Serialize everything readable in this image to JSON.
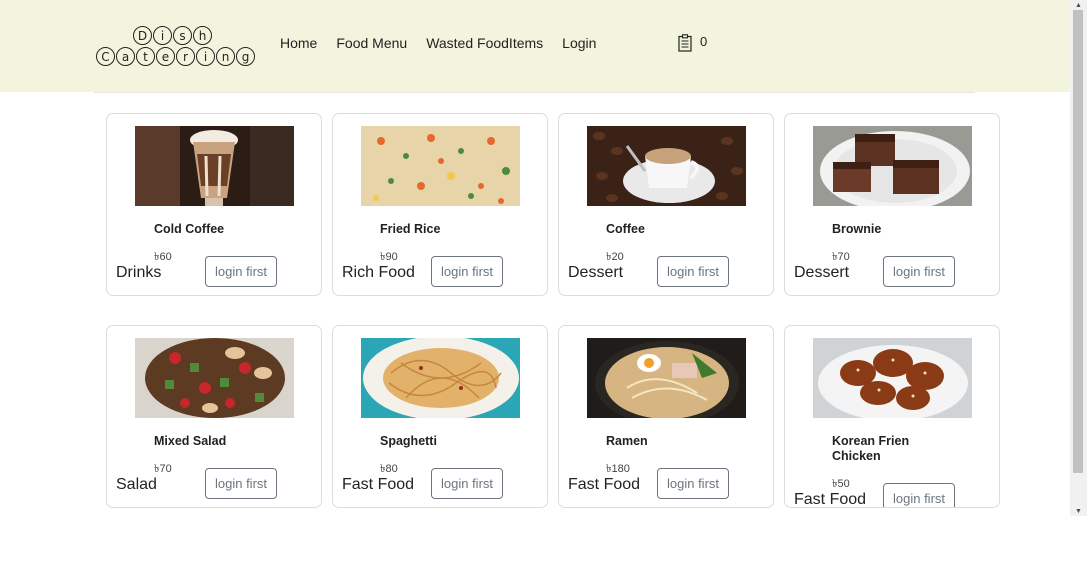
{
  "brand": {
    "line1": [
      "D",
      "i",
      "s",
      "h"
    ],
    "line2": [
      "C",
      "a",
      "t",
      "e",
      "r",
      "i",
      "n",
      "g"
    ]
  },
  "nav": {
    "items": [
      "Home",
      "Food Menu",
      "Wasted FoodItems",
      "Login"
    ]
  },
  "cart": {
    "icon": "clipboard-list-icon",
    "count": "0"
  },
  "colors": {
    "navbar_bg": "#f3f4dd",
    "button_border": "#6c757d"
  },
  "products": [
    {
      "name": "Cold Coffee",
      "price": "৳60",
      "category": "Drinks",
      "button": "login first",
      "image": "cold-coffee-image"
    },
    {
      "name": "Fried Rice",
      "price": "৳90",
      "category": "Rich Food",
      "button": "login first",
      "image": "fried-rice-image"
    },
    {
      "name": "Coffee",
      "price": "৳20",
      "category": "Dessert",
      "button": "login first",
      "image": "coffee-image"
    },
    {
      "name": "Brownie",
      "price": "৳70",
      "category": "Dessert",
      "button": "login first",
      "image": "brownie-image"
    },
    {
      "name": "Mixed Salad",
      "price": "৳70",
      "category": "Salad",
      "button": "login first",
      "image": "mixed-salad-image"
    },
    {
      "name": "Spaghetti",
      "price": "৳80",
      "category": "Fast Food",
      "button": "login first",
      "image": "spaghetti-image"
    },
    {
      "name": "Ramen",
      "price": "৳180",
      "category": "Fast Food",
      "button": "login first",
      "image": "ramen-image"
    },
    {
      "name": "Korean Frien Chicken",
      "price": "৳50",
      "category": "Fast Food",
      "button": "login first",
      "image": "korean-chicken-image"
    }
  ]
}
